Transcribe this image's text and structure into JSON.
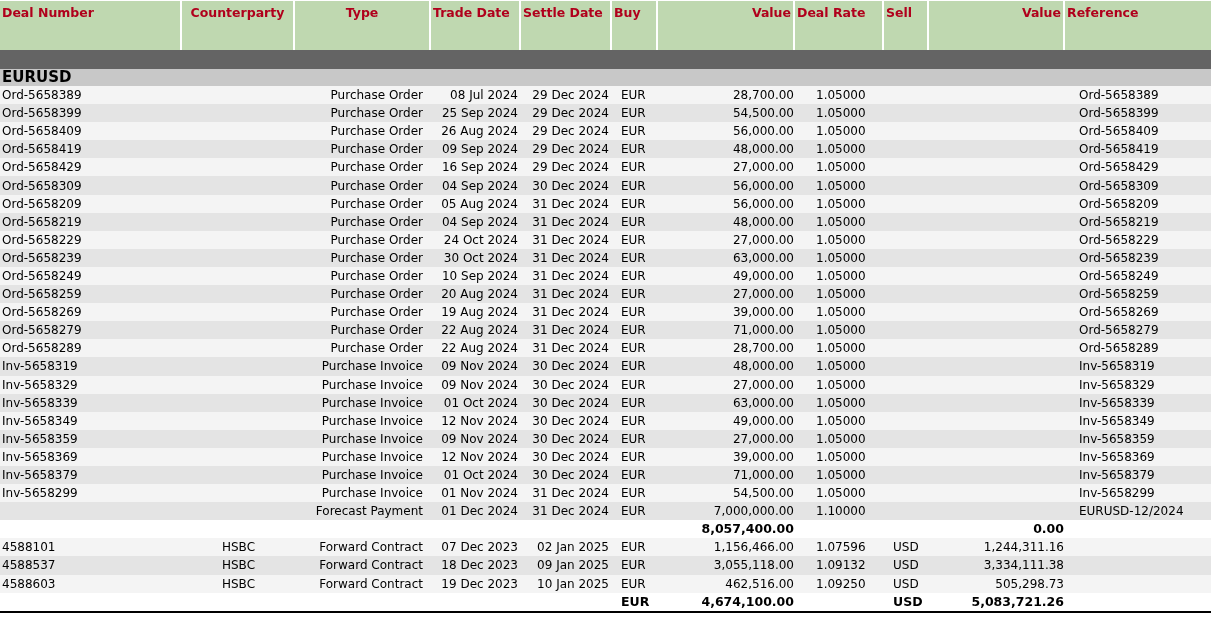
{
  "columns": [
    {
      "label": "Deal Number"
    },
    {
      "label": "Counterparty"
    },
    {
      "label": "Type"
    },
    {
      "label": "Trade Date"
    },
    {
      "label": "Settle Date"
    },
    {
      "label": "Buy"
    },
    {
      "label": "Value"
    },
    {
      "label": "Deal Rate"
    },
    {
      "label": "Sell"
    },
    {
      "label": "Value"
    },
    {
      "label": "Reference"
    }
  ],
  "group": {
    "title": "EURUSD"
  },
  "rows": [
    {
      "kind": "row",
      "deal_number": "Ord-5658389",
      "type": "Purchase Order",
      "trade_date": "08 Jul 2024",
      "settle_date": "29 Dec 2024",
      "buy": "EUR",
      "buy_value": "28,700.00",
      "deal_rate": "1.05000",
      "reference": "Ord-5658389"
    },
    {
      "kind": "row",
      "deal_number": "Ord-5658399",
      "type": "Purchase Order",
      "trade_date": "25 Sep 2024",
      "settle_date": "29 Dec 2024",
      "buy": "EUR",
      "buy_value": "54,500.00",
      "deal_rate": "1.05000",
      "reference": "Ord-5658399"
    },
    {
      "kind": "row",
      "deal_number": "Ord-5658409",
      "type": "Purchase Order",
      "trade_date": "26 Aug 2024",
      "settle_date": "29 Dec 2024",
      "buy": "EUR",
      "buy_value": "56,000.00",
      "deal_rate": "1.05000",
      "reference": "Ord-5658409"
    },
    {
      "kind": "row",
      "deal_number": "Ord-5658419",
      "type": "Purchase Order",
      "trade_date": "09 Sep 2024",
      "settle_date": "29 Dec 2024",
      "buy": "EUR",
      "buy_value": "48,000.00",
      "deal_rate": "1.05000",
      "reference": "Ord-5658419"
    },
    {
      "kind": "row",
      "deal_number": "Ord-5658429",
      "type": "Purchase Order",
      "trade_date": "16 Sep 2024",
      "settle_date": "29 Dec 2024",
      "buy": "EUR",
      "buy_value": "27,000.00",
      "deal_rate": "1.05000",
      "reference": "Ord-5658429"
    },
    {
      "kind": "row",
      "deal_number": "Ord-5658309",
      "type": "Purchase Order",
      "trade_date": "04 Sep 2024",
      "settle_date": "30 Dec 2024",
      "buy": "EUR",
      "buy_value": "56,000.00",
      "deal_rate": "1.05000",
      "reference": "Ord-5658309"
    },
    {
      "kind": "row",
      "deal_number": "Ord-5658209",
      "type": "Purchase Order",
      "trade_date": "05 Aug 2024",
      "settle_date": "31 Dec 2024",
      "buy": "EUR",
      "buy_value": "56,000.00",
      "deal_rate": "1.05000",
      "reference": "Ord-5658209"
    },
    {
      "kind": "row",
      "deal_number": "Ord-5658219",
      "type": "Purchase Order",
      "trade_date": "04 Sep 2024",
      "settle_date": "31 Dec 2024",
      "buy": "EUR",
      "buy_value": "48,000.00",
      "deal_rate": "1.05000",
      "reference": "Ord-5658219"
    },
    {
      "kind": "row",
      "deal_number": "Ord-5658229",
      "type": "Purchase Order",
      "trade_date": "24 Oct 2024",
      "settle_date": "31 Dec 2024",
      "buy": "EUR",
      "buy_value": "27,000.00",
      "deal_rate": "1.05000",
      "reference": "Ord-5658229"
    },
    {
      "kind": "row",
      "deal_number": "Ord-5658239",
      "type": "Purchase Order",
      "trade_date": "30 Oct 2024",
      "settle_date": "31 Dec 2024",
      "buy": "EUR",
      "buy_value": "63,000.00",
      "deal_rate": "1.05000",
      "reference": "Ord-5658239"
    },
    {
      "kind": "row",
      "deal_number": "Ord-5658249",
      "type": "Purchase Order",
      "trade_date": "10 Sep 2024",
      "settle_date": "31 Dec 2024",
      "buy": "EUR",
      "buy_value": "49,000.00",
      "deal_rate": "1.05000",
      "reference": "Ord-5658249"
    },
    {
      "kind": "row",
      "deal_number": "Ord-5658259",
      "type": "Purchase Order",
      "trade_date": "20 Aug 2024",
      "settle_date": "31 Dec 2024",
      "buy": "EUR",
      "buy_value": "27,000.00",
      "deal_rate": "1.05000",
      "reference": "Ord-5658259"
    },
    {
      "kind": "row",
      "deal_number": "Ord-5658269",
      "type": "Purchase Order",
      "trade_date": "19 Aug 2024",
      "settle_date": "31 Dec 2024",
      "buy": "EUR",
      "buy_value": "39,000.00",
      "deal_rate": "1.05000",
      "reference": "Ord-5658269"
    },
    {
      "kind": "row",
      "deal_number": "Ord-5658279",
      "type": "Purchase Order",
      "trade_date": "22 Aug 2024",
      "settle_date": "31 Dec 2024",
      "buy": "EUR",
      "buy_value": "71,000.00",
      "deal_rate": "1.05000",
      "reference": "Ord-5658279"
    },
    {
      "kind": "row",
      "deal_number": "Ord-5658289",
      "type": "Purchase Order",
      "trade_date": "22 Aug 2024",
      "settle_date": "31 Dec 2024",
      "buy": "EUR",
      "buy_value": "28,700.00",
      "deal_rate": "1.05000",
      "reference": "Ord-5658289"
    },
    {
      "kind": "row",
      "deal_number": "Inv-5658319",
      "type": "Purchase Invoice",
      "trade_date": "09 Nov 2024",
      "settle_date": "30 Dec 2024",
      "buy": "EUR",
      "buy_value": "48,000.00",
      "deal_rate": "1.05000",
      "reference": "Inv-5658319"
    },
    {
      "kind": "row",
      "deal_number": "Inv-5658329",
      "type": "Purchase Invoice",
      "trade_date": "09 Nov 2024",
      "settle_date": "30 Dec 2024",
      "buy": "EUR",
      "buy_value": "27,000.00",
      "deal_rate": "1.05000",
      "reference": "Inv-5658329"
    },
    {
      "kind": "row",
      "deal_number": "Inv-5658339",
      "type": "Purchase Invoice",
      "trade_date": "01 Oct 2024",
      "settle_date": "30 Dec 2024",
      "buy": "EUR",
      "buy_value": "63,000.00",
      "deal_rate": "1.05000",
      "reference": "Inv-5658339"
    },
    {
      "kind": "row",
      "deal_number": "Inv-5658349",
      "type": "Purchase Invoice",
      "trade_date": "12 Nov 2024",
      "settle_date": "30 Dec 2024",
      "buy": "EUR",
      "buy_value": "49,000.00",
      "deal_rate": "1.05000",
      "reference": "Inv-5658349"
    },
    {
      "kind": "row",
      "deal_number": "Inv-5658359",
      "type": "Purchase Invoice",
      "trade_date": "09 Nov 2024",
      "settle_date": "30 Dec 2024",
      "buy": "EUR",
      "buy_value": "27,000.00",
      "deal_rate": "1.05000",
      "reference": "Inv-5658359"
    },
    {
      "kind": "row",
      "deal_number": "Inv-5658369",
      "type": "Purchase Invoice",
      "trade_date": "12 Nov 2024",
      "settle_date": "30 Dec 2024",
      "buy": "EUR",
      "buy_value": "39,000.00",
      "deal_rate": "1.05000",
      "reference": "Inv-5658369"
    },
    {
      "kind": "row",
      "deal_number": "Inv-5658379",
      "type": "Purchase Invoice",
      "trade_date": "01 Oct 2024",
      "settle_date": "30 Dec 2024",
      "buy": "EUR",
      "buy_value": "71,000.00",
      "deal_rate": "1.05000",
      "reference": "Inv-5658379"
    },
    {
      "kind": "row",
      "deal_number": "Inv-5658299",
      "type": "Purchase Invoice",
      "trade_date": "01 Nov 2024",
      "settle_date": "31 Dec 2024",
      "buy": "EUR",
      "buy_value": "54,500.00",
      "deal_rate": "1.05000",
      "reference": "Inv-5658299"
    },
    {
      "kind": "row",
      "type": "Forecast Payment",
      "trade_date": "01 Dec 2024",
      "settle_date": "31 Dec 2024",
      "buy": "EUR",
      "buy_value": "7,000,000.00",
      "deal_rate": "1.10000",
      "reference": "EURUSD-12/2024"
    },
    {
      "kind": "total",
      "buy_value": "8,057,400.00",
      "sell_value": "0.00"
    },
    {
      "kind": "row",
      "deal_number": "4588101",
      "counterparty": "HSBC",
      "type": "Forward Contract",
      "trade_date": "07 Dec 2023",
      "settle_date": "02 Jan 2025",
      "buy": "EUR",
      "buy_value": "1,156,466.00",
      "deal_rate": "1.07596",
      "sell": "USD",
      "sell_value": "1,244,311.16"
    },
    {
      "kind": "row",
      "deal_number": "4588537",
      "counterparty": "HSBC",
      "type": "Forward Contract",
      "trade_date": "18 Dec 2023",
      "settle_date": "09 Jan 2025",
      "buy": "EUR",
      "buy_value": "3,055,118.00",
      "deal_rate": "1.09132",
      "sell": "USD",
      "sell_value": "3,334,111.38"
    },
    {
      "kind": "row",
      "deal_number": "4588603",
      "counterparty": "HSBC",
      "type": "Forward Contract",
      "trade_date": "19 Dec 2023",
      "settle_date": "10 Jan 2025",
      "buy": "EUR",
      "buy_value": "462,516.00",
      "deal_rate": "1.09250",
      "sell": "USD",
      "sell_value": "505,298.73"
    },
    {
      "kind": "grand_total",
      "buy": "EUR",
      "buy_value": "4,674,100.00",
      "sell": "USD",
      "sell_value": "5,083,721.26"
    }
  ]
}
